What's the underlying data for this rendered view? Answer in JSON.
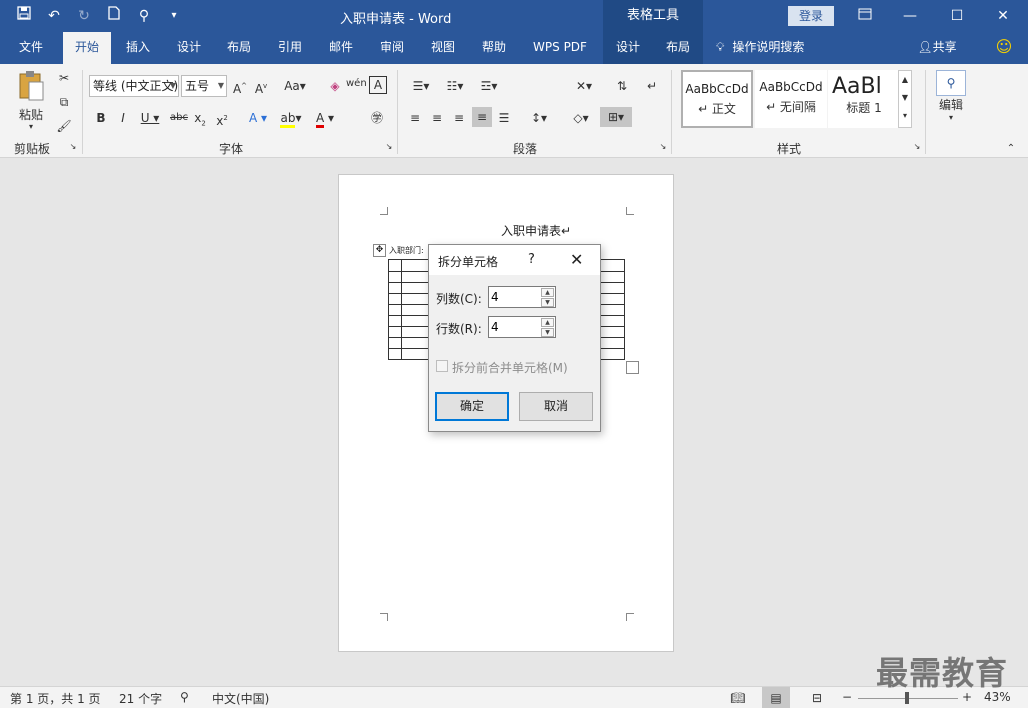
{
  "title_bar": {
    "doc_title": "入职申请表  -  Word",
    "context_tool": "表格工具",
    "login": "登录",
    "qat_icons": [
      "save-icon",
      "undo-icon",
      "redo-icon",
      "new-doc-icon",
      "touch-mode-icon",
      "customize-qat-icon"
    ]
  },
  "tabs": [
    {
      "label": "文件"
    },
    {
      "label": "开始"
    },
    {
      "label": "插入"
    },
    {
      "label": "设计"
    },
    {
      "label": "布局"
    },
    {
      "label": "引用"
    },
    {
      "label": "邮件"
    },
    {
      "label": "审阅"
    },
    {
      "label": "视图"
    },
    {
      "label": "帮助"
    },
    {
      "label": "WPS PDF"
    },
    {
      "label": "设计"
    },
    {
      "label": "布局"
    },
    {
      "label": "操作说明搜索"
    },
    {
      "label": "共享"
    }
  ],
  "active_tab": "开始",
  "ribbon": {
    "clipboard": {
      "paste": "粘贴",
      "group": "剪贴板"
    },
    "font": {
      "name": "等线 (中文正文)",
      "size": "五号",
      "group": "字体"
    },
    "paragraph": {
      "group": "段落"
    },
    "styles": {
      "group": "样式",
      "items": [
        {
          "sample": "AaBbCcDd",
          "name": "↵ 正文"
        },
        {
          "sample": "AaBbCcDd",
          "name": "↵ 无间隔"
        },
        {
          "sample": "AaBl",
          "name": "标题 1"
        }
      ]
    },
    "editing": {
      "label": "编辑"
    }
  },
  "document": {
    "title": "入职申请表↵",
    "dept_label": "入职部门:"
  },
  "dialog": {
    "title": "拆分单元格",
    "help": "?",
    "columns_label": "列数(C):",
    "columns_value": "4",
    "rows_label": "行数(R):",
    "rows_value": "4",
    "merge_label": "拆分前合并单元格(M)",
    "ok": "确定",
    "cancel": "取消"
  },
  "status_bar": {
    "page": "第 1 页，共 1 页",
    "words": "21 个字",
    "language": "中文(中国)",
    "zoom": "43%",
    "zoom_minus": "−",
    "zoom_plus": "+"
  },
  "watermark": "最需教育",
  "colors": {
    "accent": "#2b579a",
    "ribbon_bg": "#f3f3f3",
    "doc_bg": "#e6e6e6"
  }
}
